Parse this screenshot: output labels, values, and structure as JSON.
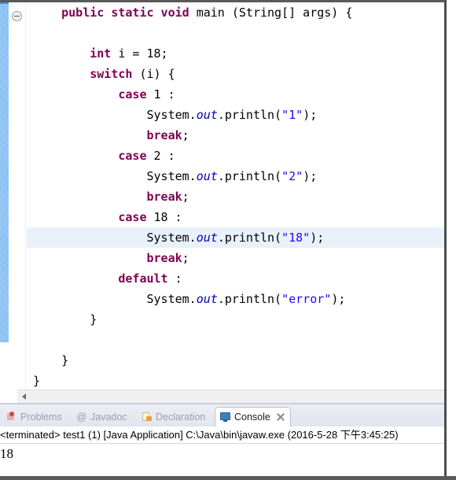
{
  "editor": {
    "fold_icon": "collapse-fold-icon",
    "highlighted_line_index": 11,
    "lines": [
      [
        {
          "t": "    ",
          "c": "plain"
        },
        {
          "t": "public static void",
          "c": "kw"
        },
        {
          "t": " main (String[] args) {",
          "c": "plain"
        }
      ],
      [],
      [
        {
          "t": "        ",
          "c": "plain"
        },
        {
          "t": "int",
          "c": "kw"
        },
        {
          "t": " i = 18;",
          "c": "plain"
        }
      ],
      [
        {
          "t": "        ",
          "c": "plain"
        },
        {
          "t": "switch",
          "c": "kw"
        },
        {
          "t": " (i) {",
          "c": "plain"
        }
      ],
      [
        {
          "t": "            ",
          "c": "plain"
        },
        {
          "t": "case",
          "c": "kw"
        },
        {
          "t": " 1 :",
          "c": "plain"
        }
      ],
      [
        {
          "t": "                System.",
          "c": "plain"
        },
        {
          "t": "out",
          "c": "fld"
        },
        {
          "t": ".println(",
          "c": "plain"
        },
        {
          "t": "\"1\"",
          "c": "str"
        },
        {
          "t": ");",
          "c": "plain"
        }
      ],
      [
        {
          "t": "                ",
          "c": "plain"
        },
        {
          "t": "break",
          "c": "kw"
        },
        {
          "t": ";",
          "c": "plain"
        }
      ],
      [
        {
          "t": "            ",
          "c": "plain"
        },
        {
          "t": "case",
          "c": "kw"
        },
        {
          "t": " 2 :",
          "c": "plain"
        }
      ],
      [
        {
          "t": "                System.",
          "c": "plain"
        },
        {
          "t": "out",
          "c": "fld"
        },
        {
          "t": ".println(",
          "c": "plain"
        },
        {
          "t": "\"2\"",
          "c": "str"
        },
        {
          "t": ");",
          "c": "plain"
        }
      ],
      [
        {
          "t": "                ",
          "c": "plain"
        },
        {
          "t": "break",
          "c": "kw"
        },
        {
          "t": ";",
          "c": "plain"
        }
      ],
      [
        {
          "t": "            ",
          "c": "plain"
        },
        {
          "t": "case",
          "c": "kw"
        },
        {
          "t": " 18 :",
          "c": "plain"
        }
      ],
      [
        {
          "t": "                System.",
          "c": "plain"
        },
        {
          "t": "out",
          "c": "fld"
        },
        {
          "t": ".println(",
          "c": "plain"
        },
        {
          "t": "\"18\"",
          "c": "str"
        },
        {
          "t": ");",
          "c": "plain"
        }
      ],
      [
        {
          "t": "                ",
          "c": "plain"
        },
        {
          "t": "break",
          "c": "kw"
        },
        {
          "t": ";",
          "c": "plain"
        }
      ],
      [
        {
          "t": "            ",
          "c": "plain"
        },
        {
          "t": "default",
          "c": "kw"
        },
        {
          "t": " :",
          "c": "plain"
        }
      ],
      [
        {
          "t": "                System.",
          "c": "plain"
        },
        {
          "t": "out",
          "c": "fld"
        },
        {
          "t": ".println(",
          "c": "plain"
        },
        {
          "t": "\"error\"",
          "c": "str"
        },
        {
          "t": ");",
          "c": "plain"
        }
      ],
      [
        {
          "t": "        }",
          "c": "plain"
        }
      ],
      [],
      [
        {
          "t": "    }",
          "c": "plain"
        }
      ],
      [
        {
          "t": "}",
          "c": "plain"
        }
      ]
    ]
  },
  "scrollbar": {
    "left_arrow": "scroll-left-arrow"
  },
  "console_panel": {
    "tabs": [
      {
        "label": "Problems",
        "icon": "problems-icon",
        "active": false
      },
      {
        "label": "Javadoc",
        "icon": "javadoc-icon",
        "active": false
      },
      {
        "label": "Declaration",
        "icon": "declaration-icon",
        "active": false
      },
      {
        "label": "Console",
        "icon": "console-icon",
        "active": true
      }
    ],
    "active_tab_close": "close-icon",
    "terminated_line": "<terminated> test1 (1) [Java Application] C:\\Java\\bin\\javaw.exe (2016-5-28 下午3:45:25)",
    "output": "18"
  },
  "colors": {
    "keyword": "#7f0055",
    "string": "#2a00ff",
    "field": "#0000c0",
    "line_highlight": "#e9f1fb",
    "change_bar": "#8fc4f2"
  }
}
